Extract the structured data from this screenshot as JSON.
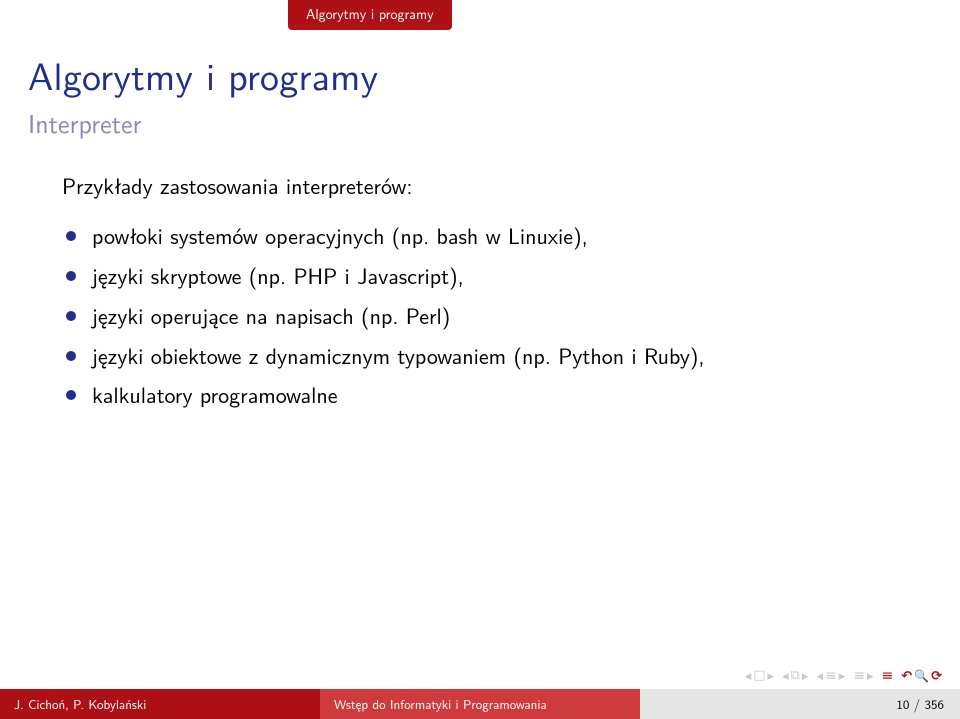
{
  "header": {
    "section": "Algorytmy i programy"
  },
  "title": {
    "main": "Algorytmy i programy",
    "sub": "Interpreter"
  },
  "body": {
    "intro": "Przykłady zastosowania interpreterów:",
    "items": [
      "powłoki systemów operacyjnych (np. bash w Linuxie),",
      "języki skryptowe (np. PHP i Javascript),",
      "języki operujące na napisach (np. Perl)",
      "języki obiektowe z dynamicznym typowaniem (np. Python i Ruby),",
      "kalkulatory programowalne"
    ]
  },
  "footer": {
    "author": "J. Cichoń, P. Kobylański",
    "course": "Wstęp do Informatyki i Programowania",
    "page": "10 / 356"
  }
}
